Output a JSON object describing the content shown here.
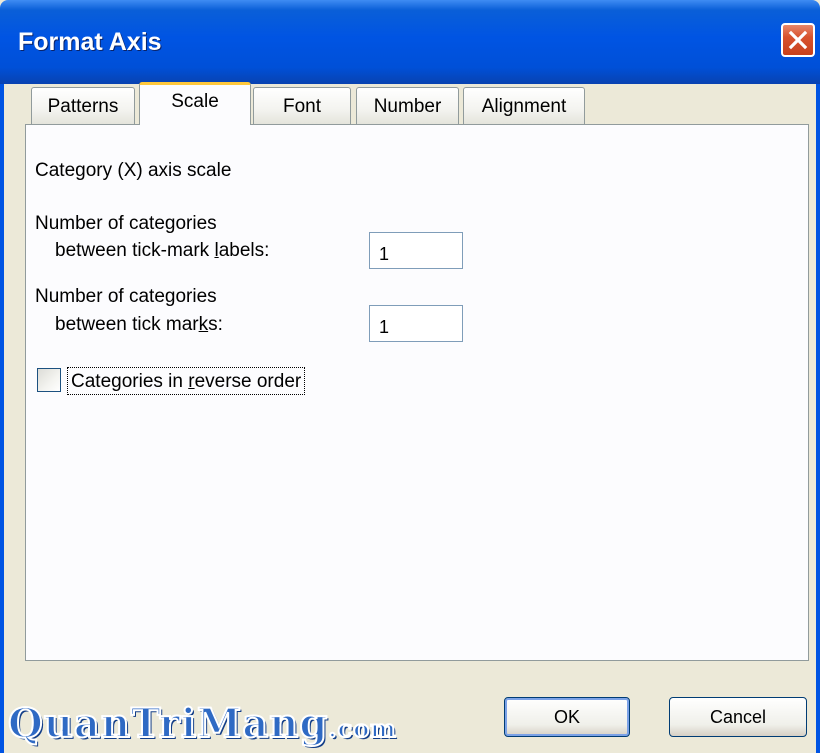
{
  "window": {
    "title": "Format Axis",
    "close_icon": "close-icon"
  },
  "tabs": [
    {
      "label": "Patterns",
      "active": false
    },
    {
      "label": "Scale",
      "active": true
    },
    {
      "label": "Font",
      "active": false
    },
    {
      "label": "Number",
      "active": false
    },
    {
      "label": "Alignment",
      "active": false
    }
  ],
  "scale": {
    "heading": "Category (X) axis scale",
    "tick_label_interval": {
      "line1": "Number of categories",
      "line2_pre": "between tick-mark ",
      "line2_accel": "l",
      "line2_post": "abels:",
      "value": "1"
    },
    "tick_mark_interval": {
      "line1": "Number of categories",
      "line2_pre": "between tick mar",
      "line2_accel": "k",
      "line2_post": "s:",
      "value": "1"
    },
    "reverse_order": {
      "pre": "Categories in ",
      "accel": "r",
      "post": "everse order",
      "checked": false
    }
  },
  "buttons": {
    "ok": "OK",
    "cancel": "Cancel"
  },
  "watermark": {
    "main": "QuanTriMang",
    "suffix": ".com"
  },
  "colors": {
    "titlebar": "#0054e3",
    "active_tab_accent": "#ffc83c",
    "close_button": "#d8532f"
  }
}
